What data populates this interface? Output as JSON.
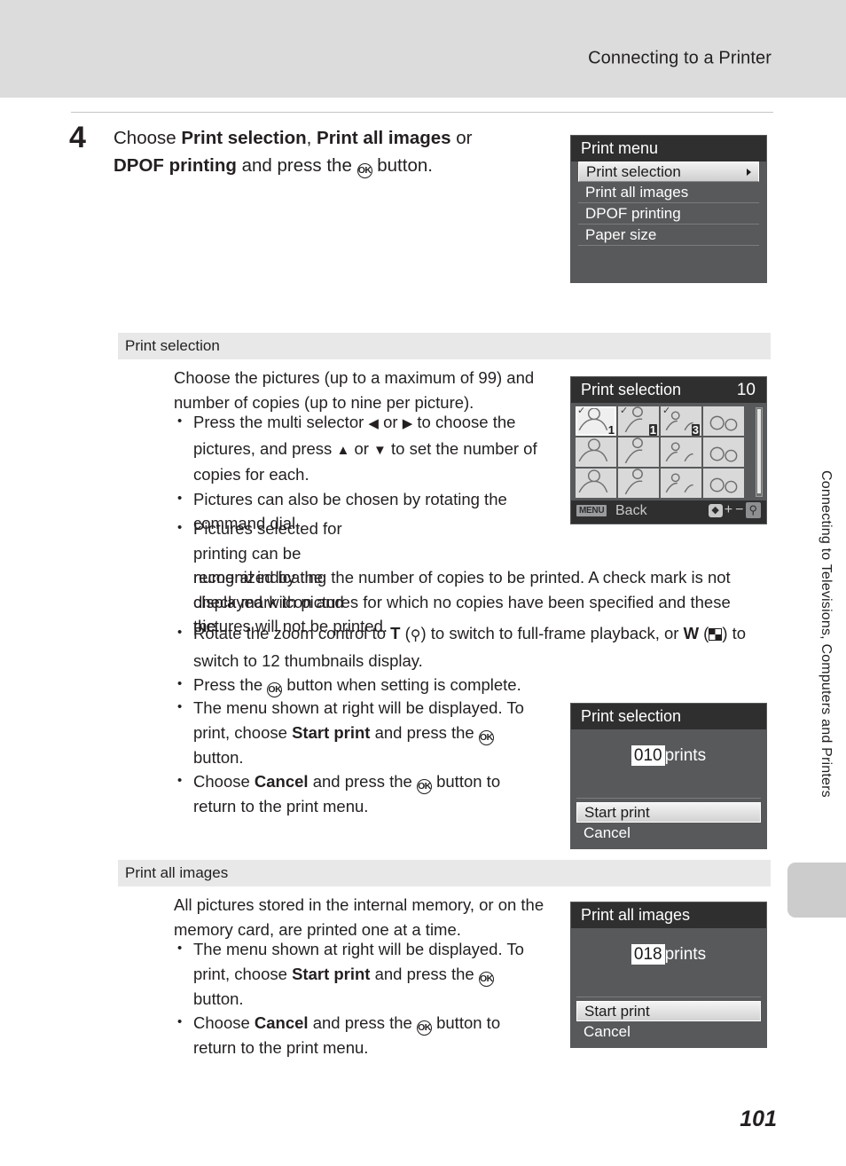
{
  "header": {
    "title": "Connecting to a Printer"
  },
  "page_number": "101",
  "side_tab": "Connecting to Televisions, Computers and Printers",
  "step": {
    "number": "4",
    "line1_pre": "Choose ",
    "bold1": "Print selection",
    "line1_mid": ", ",
    "bold2": "Print all images",
    "line1_post": " or",
    "bold3": "DPOF printing",
    "line2_post": " and press the ",
    "ok_glyph": "OK",
    "line2_end": " button."
  },
  "print_menu_screen": {
    "title": "Print menu",
    "items": [
      {
        "label": "Print selection",
        "selected": true
      },
      {
        "label": "Print all images",
        "selected": false
      },
      {
        "label": "DPOF printing",
        "selected": false
      },
      {
        "label": "Paper size",
        "selected": false
      }
    ]
  },
  "section_print_selection": {
    "heading": "Print selection",
    "intro": "Choose the pictures (up to a maximum of 99) and number of copies (up to nine per picture).",
    "bullets": [
      "Press the multi selector ◀ or ▶ to choose the pictures, and press ▲ or ▼ to set the number of copies for each.",
      "Pictures can also be chosen by rotating the command dial.",
      "Pictures selected for printing can be recognized by the check mark icon and the numeral indicating the number of copies to be printed. A check mark is not displayed with pictures for which no copies have been specified and these pictures will not be printed.",
      "Rotate the zoom control to T (⌕) to switch to full-frame playback, or W (▦) to switch to 12 thumbnails display.",
      "Press the OK button when setting is complete."
    ],
    "menu_bullets": [
      {
        "pre": "The menu shown at right will be displayed. To print, choose ",
        "bold": "Start print",
        "mid": " and press the ",
        "post": " button."
      },
      {
        "pre": "Choose ",
        "bold": "Cancel",
        "mid": " and press the ",
        "post": " button to return to the print menu."
      }
    ]
  },
  "thumbnail_screen": {
    "title": "Print selection",
    "count": "10",
    "back_chip": "MENU",
    "back_label": "Back",
    "cells": [
      {
        "selected": true,
        "check": "✓",
        "copies": "1",
        "badge": false
      },
      {
        "selected": false,
        "check": "✓",
        "copies": "1",
        "badge": true
      },
      {
        "selected": false,
        "check": "✓",
        "copies": "3",
        "badge": true
      },
      {
        "selected": false,
        "check": "",
        "copies": "",
        "badge": false
      },
      {
        "selected": false,
        "check": "",
        "copies": "",
        "badge": false
      },
      {
        "selected": false,
        "check": "",
        "copies": "",
        "badge": false
      },
      {
        "selected": false,
        "check": "",
        "copies": "",
        "badge": false
      },
      {
        "selected": false,
        "check": "",
        "copies": "",
        "badge": false
      },
      {
        "selected": false,
        "check": "",
        "copies": "",
        "badge": false
      },
      {
        "selected": false,
        "check": "",
        "copies": "",
        "badge": false
      },
      {
        "selected": false,
        "check": "",
        "copies": "",
        "badge": false
      },
      {
        "selected": false,
        "check": "",
        "copies": "",
        "badge": false
      }
    ]
  },
  "print_selection_confirm": {
    "title": "Print selection",
    "count": "010",
    "count_unit": "prints",
    "buttons": [
      {
        "label": "Start print",
        "selected": true
      },
      {
        "label": "Cancel",
        "selected": false
      }
    ]
  },
  "section_print_all": {
    "heading": "Print all images",
    "intro": "All pictures stored in the internal memory, or on the memory card, are printed one at a time.",
    "menu_bullets": [
      {
        "pre": "The menu shown at right will be displayed. To print, choose ",
        "bold": "Start print",
        "mid": " and press the ",
        "post": " button."
      },
      {
        "pre": "Choose ",
        "bold": "Cancel",
        "mid": " and press the ",
        "post": " button to return to the print menu."
      }
    ]
  },
  "print_all_confirm": {
    "title": "Print all images",
    "count": "018",
    "count_unit": "prints",
    "buttons": [
      {
        "label": "Start print",
        "selected": true
      },
      {
        "label": "Cancel",
        "selected": false
      }
    ]
  }
}
